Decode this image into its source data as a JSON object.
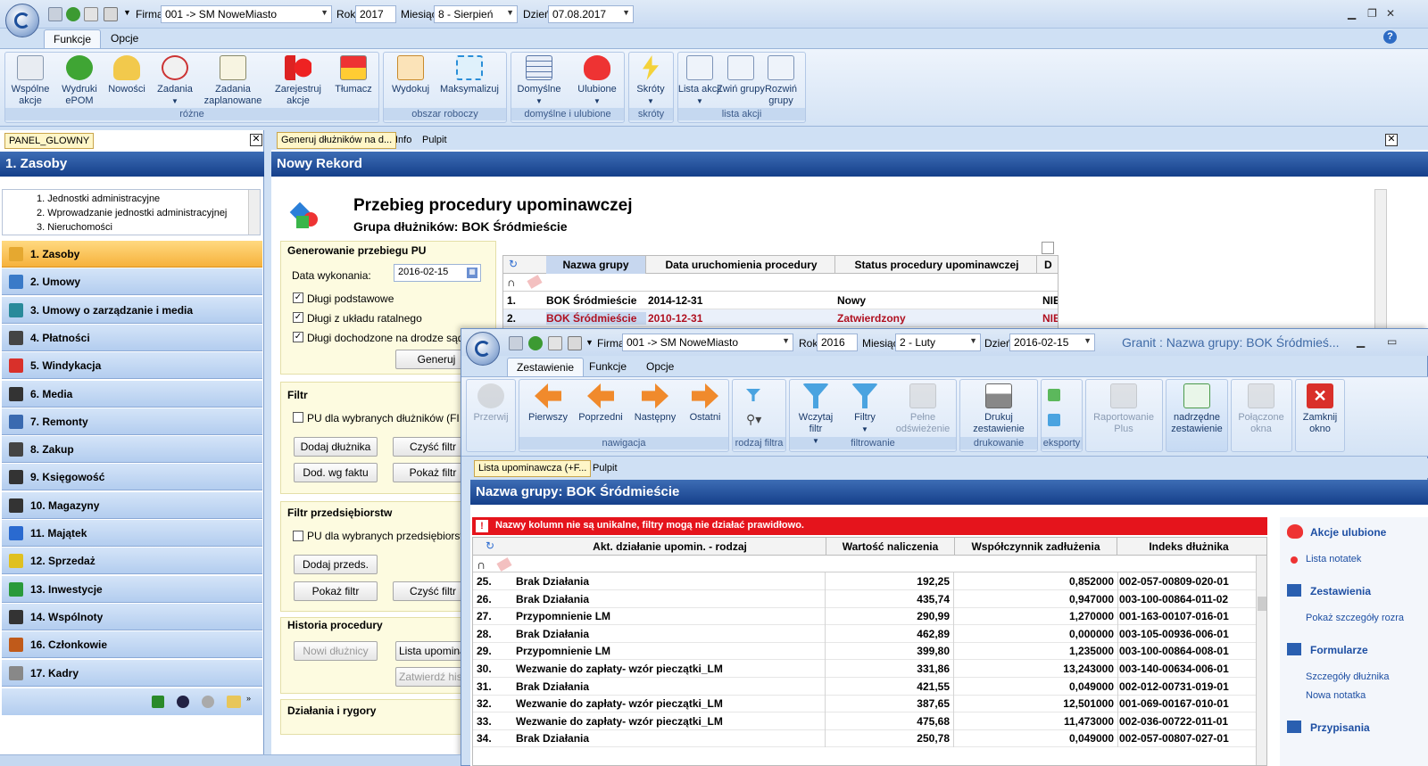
{
  "top": {
    "firma_label": "Firma",
    "firma_value": "001 -> SM NoweMiasto",
    "rok_label": "Rok",
    "rok_value": "2017",
    "miesiac_label": "Miesiąc",
    "miesiac_value": "8 - Sierpień",
    "dzien_label": "Dzień",
    "dzien_value": "07.08.2017",
    "tabs": [
      "Funkcje",
      "Opcje"
    ]
  },
  "ribbon": {
    "buttons": [
      "Wspólne akcje",
      "Wydruki ePOM",
      "Nowości",
      "Zadania",
      "Zadania zaplanowane",
      "Zarejestruj akcje",
      "Tłumacz",
      "Wydokuj",
      "Maksymalizuj",
      "Domyślne",
      "Ulubione",
      "Skróty",
      "Lista akcji",
      "Zwiń grupy",
      "Rozwiń grupy"
    ],
    "groups": [
      "różne",
      "obszar roboczy",
      "domyślne i ulubione",
      "skróty",
      "lista akcji"
    ]
  },
  "left": {
    "panel_tab": "PANEL_GLOWNY",
    "header": "1. Zasoby",
    "tree": [
      "1. Jednostki administracyjne",
      "2. Wprowadzanie jednostki administracyjnej",
      "3. Nieruchomości"
    ],
    "nav": [
      "1. Zasoby",
      "2. Umowy",
      "3. Umowy o zarządzanie i media",
      "4. Płatności",
      "5. Windykacja",
      "6. Media",
      "7. Remonty",
      "8. Zakup",
      "9. Księgowość",
      "10. Magazyny",
      "11. Majątek",
      "12. Sprzedaż",
      "13. Inwestycje",
      "14. Wspólnoty",
      "16. Członkowie",
      "17. Kadry"
    ]
  },
  "doc": {
    "tabs": [
      "Generuj dłużników na d...",
      "Info",
      "Pulpit"
    ],
    "header": "Nowy Rekord",
    "title": "Przebieg procedury upominawczej",
    "subtitle": "Grupa dłużników: BOK Śródmieście",
    "gen_section": "Generowanie przebiegu PU",
    "data_label": "Data wykonania:",
    "data_value": "2016-02-15",
    "checks": [
      "Długi podstawowe",
      "Długi z układu ratalnego",
      "Długi dochodzone na drodze sądowej"
    ],
    "generuj": "Generuj",
    "filtr_section": "Filtr",
    "filtr_check": "PU dla wybranych dłużników (FILTR)",
    "dodaj_dluznika": "Dodaj dłużnika",
    "czysc_filtr": "Czyść filtr",
    "dod_wg_faktu": "Dod. wg faktu",
    "pokaz_filtr": "Pokaż filtr",
    "filtr_przeds_section": "Filtr przedsiębiorstw",
    "przeds_check": "PU dla wybranych przedsiębiorstw",
    "dodaj_przeds": "Dodaj przeds.",
    "pokaz_filtr2": "Pokaż filtr",
    "czysc_filtr2": "Czyść filtr",
    "historia_section": "Historia procedury",
    "nowi_dluznicy": "Nowi dłużnicy",
    "lista_upomin": "Lista upominaw",
    "zatwierdz": "Zatwierdź hist",
    "dzialania_section": "Działania i rygory",
    "grid_cols": [
      "Nazwa grupy",
      "Data uruchomienia procedury",
      "Status procedury upominawczej",
      "D"
    ],
    "grid_rows": [
      {
        "n": "1.",
        "a": "BOK Śródmieście",
        "b": "2014-12-31",
        "c": "Nowy",
        "d": "NIE"
      },
      {
        "n": "2.",
        "a": "BOK Śródmieście",
        "b": "2010-12-31",
        "c": "Zatwierdzony",
        "d": "NIE"
      }
    ]
  },
  "win2": {
    "firma_value": "001 -> SM NoweMiasto",
    "rok_value": "2016",
    "miesiac_value": "2 - Luty",
    "dzien_value": "2016-02-15",
    "title": "Granit : Nazwa grupy: BOK Śródmieś...",
    "tabs": [
      "Zestawienie",
      "Funkcje",
      "Opcje"
    ],
    "buttons": [
      "Przerwij",
      "Pierwszy",
      "Poprzedni",
      "Następny",
      "Ostatni",
      "Wczytaj filtr",
      "Filtry",
      "Pełne odświeżenie",
      "Drukuj zestawienie",
      "Raportowanie Plus",
      "nadrzędne zestawienie",
      "Połączone okna",
      "Zamknij okno"
    ],
    "groups": [
      "nawigacja",
      "rodzaj filtra",
      "filtrowanie",
      "drukowanie",
      "eksporty"
    ],
    "doc_tabs": [
      "Lista upominawcza (+F...",
      "Pulpit"
    ],
    "header": "Nazwa grupy: BOK Śródmieście",
    "warning": "Nazwy kolumn nie są unikalne, filtry mogą nie działać prawidłowo.",
    "cols": [
      "Akt. działanie upomin. - rodzaj",
      "Wartość naliczenia",
      "Współczynnik zadłużenia",
      "Indeks dłużnika"
    ],
    "rows": [
      {
        "n": "25.",
        "a": "Brak Działania",
        "b": "192,25",
        "c": "0,852000",
        "d": "002-057-00809-020-01"
      },
      {
        "n": "26.",
        "a": "Brak Działania",
        "b": "435,74",
        "c": "0,947000",
        "d": "003-100-00864-011-02"
      },
      {
        "n": "27.",
        "a": "Przypomnienie LM",
        "b": "290,99",
        "c": "1,270000",
        "d": "001-163-00107-016-01"
      },
      {
        "n": "28.",
        "a": "Brak Działania",
        "b": "462,89",
        "c": "0,000000",
        "d": "003-105-00936-006-01"
      },
      {
        "n": "29.",
        "a": "Przypomnienie LM",
        "b": "399,80",
        "c": "1,235000",
        "d": "003-100-00864-008-01"
      },
      {
        "n": "30.",
        "a": "Wezwanie do zapłaty- wzór pieczątki_LM",
        "b": "331,86",
        "c": "13,243000",
        "d": "003-140-00634-006-01"
      },
      {
        "n": "31.",
        "a": "Brak Działania",
        "b": "421,55",
        "c": "0,049000",
        "d": "002-012-00731-019-01"
      },
      {
        "n": "32.",
        "a": "Wezwanie do zapłaty- wzór pieczątki_LM",
        "b": "387,65",
        "c": "12,501000",
        "d": "001-069-00167-010-01"
      },
      {
        "n": "33.",
        "a": "Wezwanie do zapłaty- wzór pieczątki_LM",
        "b": "475,68",
        "c": "11,473000",
        "d": "002-036-00722-011-01"
      },
      {
        "n": "34.",
        "a": "Brak Działania",
        "b": "250,78",
        "c": "0,049000",
        "d": "002-057-00807-027-01"
      }
    ],
    "side": {
      "akcje": "Akcje ulubione",
      "lista_notatek": "Lista notatek",
      "zestawienia": "Zestawienia",
      "pokaz": "Pokaż szczegóły rozra",
      "formularze": "Formularze",
      "szczegoly": "Szczegóły dłużnika",
      "nowa_notatka": "Nowa notatka",
      "przypisania": "Przypisania"
    }
  }
}
